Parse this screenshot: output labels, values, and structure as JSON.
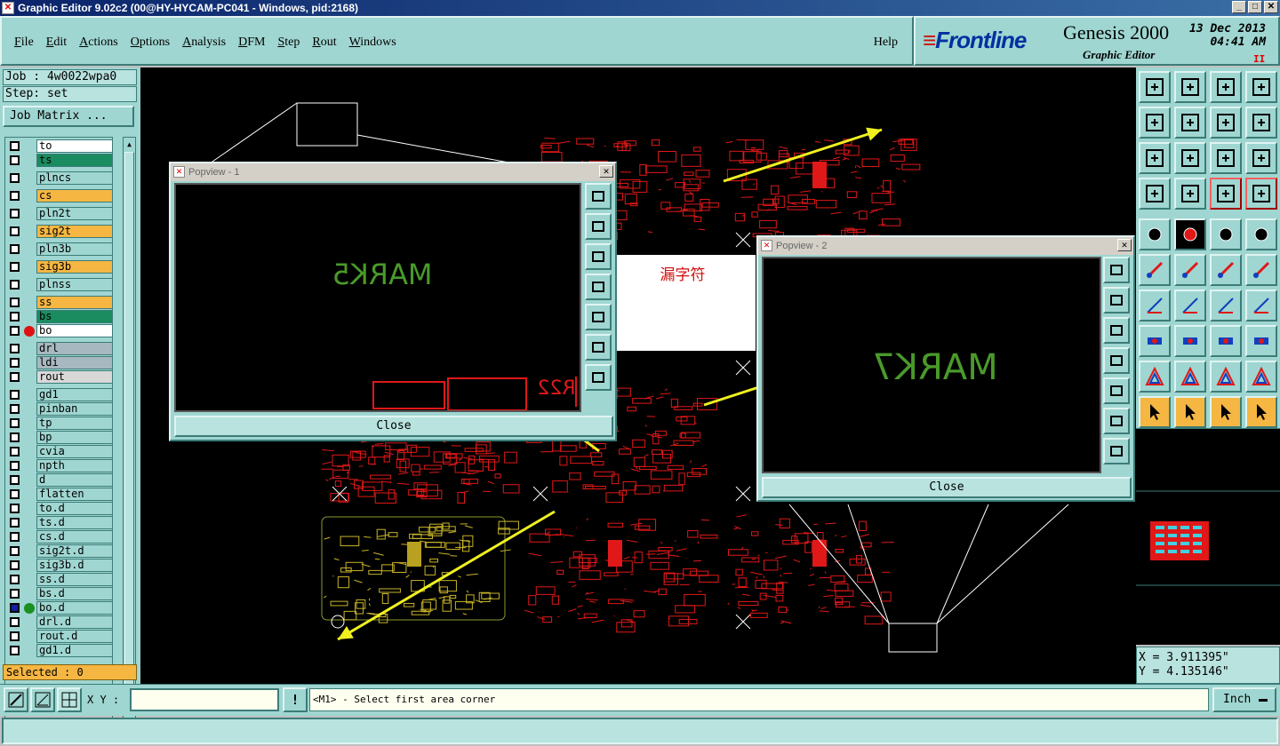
{
  "window": {
    "title": "Graphic Editor 9.02c2 (00@HY-HYCAM-PC041 - Windows, pid:2168)"
  },
  "menu": {
    "items": [
      "File",
      "Edit",
      "Actions",
      "Options",
      "Analysis",
      "DFM",
      "Step",
      "Rout",
      "Windows"
    ],
    "help": "Help"
  },
  "brand": {
    "logo": "Frontline",
    "product": "Genesis 2000",
    "subtitle": "Graphic Editor",
    "date": "13 Dec 2013",
    "time": "04:41 AM",
    "pause": "II"
  },
  "job": {
    "job_label": "Job : 4w0022wpa0",
    "step_label": "Step: set",
    "matrix_button": "Job Matrix ..."
  },
  "layers": [
    {
      "name": "to",
      "bg": "#ffffff",
      "dot": ""
    },
    {
      "name": "ts",
      "bg": "#1a8c60",
      "dot": ""
    },
    {
      "name": "plncs",
      "bg": "#9fd6d1",
      "dot": ""
    },
    {
      "name": "cs",
      "bg": "#f5b642",
      "dot": ""
    },
    {
      "name": "pln2t",
      "bg": "#9fd6d1",
      "dot": ""
    },
    {
      "name": "sig2t",
      "bg": "#f5b642",
      "dot": ""
    },
    {
      "name": "pln3b",
      "bg": "#9fd6d1",
      "dot": ""
    },
    {
      "name": "sig3b",
      "bg": "#f5b642",
      "dot": ""
    },
    {
      "name": "plnss",
      "bg": "#9fd6d1",
      "dot": ""
    },
    {
      "name": "ss",
      "bg": "#f5b642",
      "dot": ""
    },
    {
      "name": "bs",
      "bg": "#1a8c60",
      "dot": ""
    },
    {
      "name": "bo",
      "bg": "#ffffff",
      "dot": "#e01010"
    },
    {
      "name": "drl",
      "bg": "#a8b8c0",
      "dot": ""
    },
    {
      "name": "ldi",
      "bg": "#a8b8c0",
      "dot": ""
    },
    {
      "name": "rout",
      "bg": "#d8d8d8",
      "dot": ""
    },
    {
      "name": "gd1",
      "bg": "#9fd6d1",
      "dot": ""
    },
    {
      "name": "pinban",
      "bg": "#9fd6d1",
      "dot": ""
    },
    {
      "name": "tp",
      "bg": "#9fd6d1",
      "dot": ""
    },
    {
      "name": "bp",
      "bg": "#9fd6d1",
      "dot": ""
    },
    {
      "name": "cvia",
      "bg": "#9fd6d1",
      "dot": ""
    },
    {
      "name": "npth",
      "bg": "#9fd6d1",
      "dot": ""
    },
    {
      "name": "d",
      "bg": "#9fd6d1",
      "dot": ""
    },
    {
      "name": "flatten",
      "bg": "#9fd6d1",
      "dot": ""
    },
    {
      "name": "to.d",
      "bg": "#9fd6d1",
      "dot": "",
      "mark": "✎"
    },
    {
      "name": "ts.d",
      "bg": "#9fd6d1",
      "dot": ""
    },
    {
      "name": "cs.d",
      "bg": "#9fd6d1",
      "dot": ""
    },
    {
      "name": "sig2t.d",
      "bg": "#9fd6d1",
      "dot": ""
    },
    {
      "name": "sig3b.d",
      "bg": "#9fd6d1",
      "dot": ""
    },
    {
      "name": "ss.d",
      "bg": "#9fd6d1",
      "dot": ""
    },
    {
      "name": "bs.d",
      "bg": "#9fd6d1",
      "dot": ""
    },
    {
      "name": "bo.d",
      "bg": "#9fd6d1",
      "dot": "#1a9020",
      "mark": "✎⊞",
      "checked": true
    },
    {
      "name": "drl.d",
      "bg": "#9fd6d1",
      "dot": ""
    },
    {
      "name": "rout.d",
      "bg": "#9fd6d1",
      "dot": ""
    },
    {
      "name": "gd1.d",
      "bg": "#9fd6d1",
      "dot": ""
    }
  ],
  "selected": "Selected : 0",
  "popview1": {
    "title": "Popview - 1",
    "text": "MARK5",
    "close": "Close",
    "ref": "R22"
  },
  "popview2": {
    "title": "Popview - 2",
    "text": "MARK7",
    "close": "Close"
  },
  "annotation": "漏字符",
  "coords": {
    "x": "X = 3.911395\"",
    "y": "Y = 4.135146\""
  },
  "bottom": {
    "xy_label": "X Y :",
    "status": "<M1> - Select first area corner",
    "unit": "Inch"
  },
  "colors": {
    "panel": "#9fd6d1",
    "accent": "#f5b642",
    "board_red": "#e01818",
    "board_gold": "#c8b428",
    "mark_green": "#4a9a2a",
    "arrow": "#f0f020"
  }
}
